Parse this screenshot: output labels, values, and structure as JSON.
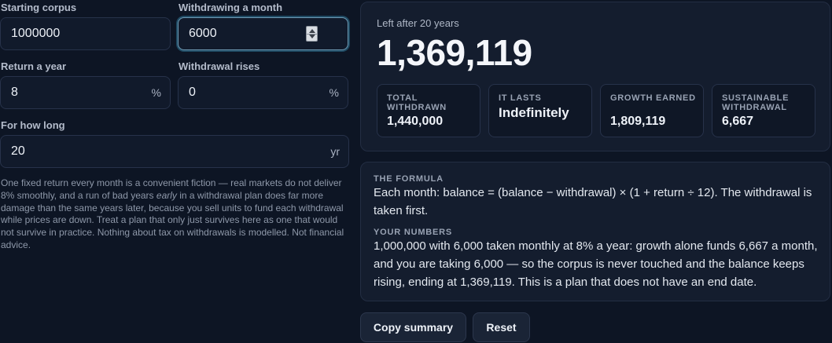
{
  "form": {
    "starting_corpus": {
      "label": "Starting corpus",
      "value": "1000000"
    },
    "withdrawing_month": {
      "label": "Withdrawing a month",
      "value": "6000"
    },
    "return_year": {
      "label": "Return a year",
      "value": "8",
      "unit": "%"
    },
    "withdrawal_rises": {
      "label": "Withdrawal rises",
      "value": "0",
      "unit": "%"
    },
    "how_long": {
      "label": "For how long",
      "value": "20",
      "unit": "yr"
    }
  },
  "note": {
    "before_em": "One fixed return every month is a convenient fiction — real markets do not deliver 8% smoothly, and a run of bad years ",
    "em": "early",
    "after_em": " in a withdrawal plan does far more damage than the same years later, because you sell units to fund each withdrawal while prices are down. Treat a plan that only just survives here as one that would not survive in practice. Nothing about tax on withdrawals is modelled. Not financial advice."
  },
  "result": {
    "label": "Left after 20 years",
    "value": "1,369,119",
    "stats": [
      {
        "label": "TOTAL WITHDRAWN",
        "value": "1,440,000"
      },
      {
        "label": "IT LASTS",
        "value": "Indefinitely"
      },
      {
        "label": "GROWTH EARNED",
        "value": "1,809,119"
      },
      {
        "label": "SUSTAINABLE WITHDRAWAL",
        "value": "6,667"
      }
    ]
  },
  "formula": {
    "title": "THE FORMULA",
    "text": "Each month: balance = (balance − withdrawal) × (1 + return ÷ 12). The withdrawal is taken first.",
    "numbers_title": "YOUR NUMBERS",
    "numbers_text": "1,000,000 with 6,000 taken monthly at 8% a year: growth alone funds 6,667 a month, and you are taking 6,000 — so the corpus is never touched and the balance keeps rising, ending at 1,369,119. This is a plan that does not have an end date."
  },
  "buttons": {
    "copy": "Copy summary",
    "reset": "Reset"
  },
  "colors": {
    "background": "#0d1524",
    "card": "#141d2e",
    "focus_ring": "#6f9ab4"
  }
}
